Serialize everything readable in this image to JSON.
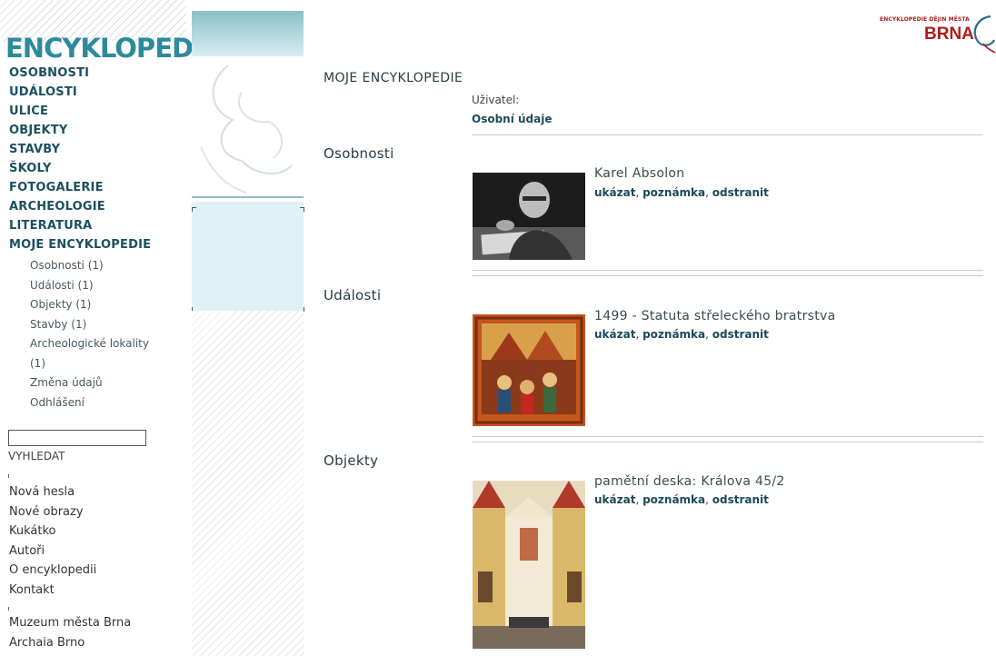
{
  "logo": {
    "text": "ENCYKLOPEDIE"
  },
  "brand": {
    "small": "ENCYKLOPEDIE DĚJIN MĚSTA",
    "big": "BRNA"
  },
  "nav_main": [
    "OSOBNOSTI",
    "UDÁLOSTI",
    "ULICE",
    "OBJEKTY",
    "STAVBY",
    "ŠKOLY",
    "FOTOGALERIE",
    "ARCHEOLOGIE",
    "LITERATURA",
    "MOJE ENCYKLOPEDIE"
  ],
  "nav_sub": [
    "Osobnosti (1)",
    "Události (1)",
    "Objekty (1)",
    "Stavby (1)",
    "Archeologické lokality",
    "(1)",
    "Změna údajů",
    "Odhlášení"
  ],
  "search": {
    "value": "",
    "button": "VYHLEDAT"
  },
  "links_a": [
    "Nová hesla",
    "Nové obrazy",
    "Kukátko",
    "Autoři",
    "O encyklopedii",
    "Kontakt"
  ],
  "links_b": [
    "Muzeum města Brna",
    "Archaia Brno"
  ],
  "main": {
    "page_title": "MOJE ENCYKLOPEDIE",
    "user_label": "Uživatel:",
    "profile_link": "Osobní údaje",
    "actions": {
      "show": "ukázat",
      "note": "poznámka",
      "remove": "odstranit",
      "sep": ", "
    },
    "sections": [
      {
        "title": "Osobnosti",
        "item": "Karel Absolon"
      },
      {
        "title": "Události",
        "item": "1499 - Statuta střeleckého bratrstva"
      },
      {
        "title": "Objekty",
        "item": "pamětní deska: Králova 45/2"
      }
    ]
  },
  "colors": {
    "accent": "#2d8a9e",
    "nav": "#1b5060",
    "brand": "#b01c1c"
  }
}
